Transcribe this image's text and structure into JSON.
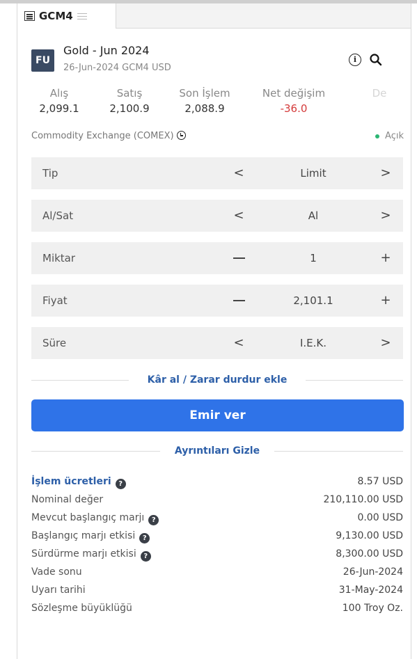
{
  "tab": {
    "label": "GCM4"
  },
  "header": {
    "badge": "FU",
    "title": "Gold - Jun 2024",
    "subtitle": "26-Jun-2024 GCM4 USD"
  },
  "quotes": [
    {
      "label": "Alış",
      "value": "2,099.1"
    },
    {
      "label": "Satış",
      "value": "2,100.9"
    },
    {
      "label": "Son İşlem",
      "value": "2,088.9"
    },
    {
      "label": "Net değişim",
      "value": "-36.0"
    },
    {
      "label": "De",
      "value": ""
    }
  ],
  "exchange": {
    "name": "Commodity Exchange (COMEX)",
    "status": "Açık"
  },
  "form": {
    "type": {
      "label": "Tip",
      "value": "Limit",
      "left": "<",
      "right": ">"
    },
    "side": {
      "label": "Al/Sat",
      "value": "Al",
      "left": "<",
      "right": ">"
    },
    "quantity": {
      "label": "Miktar",
      "value": "1",
      "right": "+"
    },
    "price": {
      "label": "Fiyat",
      "value": "2,101.1",
      "right": "+"
    },
    "duration": {
      "label": "Süre",
      "value": "I.E.K.",
      "left": "<",
      "right": ">"
    }
  },
  "links": {
    "take_profit": "Kâr al / Zarar durdur ekle",
    "hide_details": "Ayrıntıları Gizle"
  },
  "submit_label": "Emir ver",
  "details": [
    {
      "label": "İşlem ücretleri",
      "value": "8.57 USD"
    },
    {
      "label": "Nominal değer",
      "value": "210,110.00 USD"
    },
    {
      "label": "Mevcut başlangıç marjı",
      "value": "0.00 USD"
    },
    {
      "label": "Başlangıç marjı etkisi",
      "value": "9,130.00 USD"
    },
    {
      "label": "Sürdürme marjı etkisi",
      "value": "8,300.00 USD"
    },
    {
      "label": "Vade sonu",
      "value": "26-Jun-2024"
    },
    {
      "label": "Uyarı tarihi",
      "value": "31-May-2024"
    },
    {
      "label": "Sözleşme büyüklüğü",
      "value": "100 Troy Oz."
    }
  ],
  "colors": {
    "accent": "#2f73e8",
    "link": "#2d5fa8",
    "negative": "#d43a3a",
    "open_status": "#2bb673",
    "badge_bg": "#3a4a63"
  },
  "icons": {
    "tab": "calculator-icon",
    "tab_menu": "hamburger-icon",
    "info": "info-icon",
    "search": "search-icon",
    "clock": "clock-icon",
    "help": "help-icon"
  }
}
